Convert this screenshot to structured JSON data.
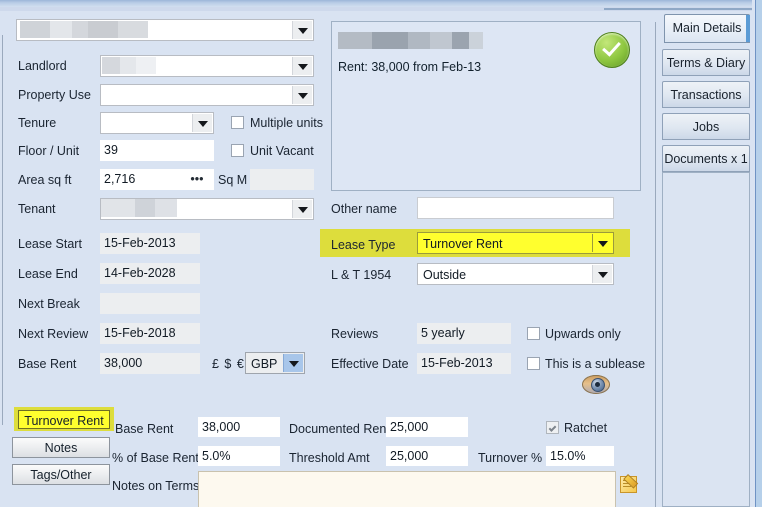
{
  "window": {
    "title": ""
  },
  "left_form": {
    "property_combo": {
      "label": "",
      "value": "",
      "redacted": true
    },
    "rows": [
      {
        "label": "Landlord",
        "value": "",
        "type": "combo",
        "redacted": true
      },
      {
        "label": "Property Use",
        "value": "",
        "type": "combo"
      },
      {
        "label": "Tenure",
        "value": "",
        "type": "combo"
      },
      {
        "label": "Floor / Unit",
        "value": "39",
        "type": "text"
      },
      {
        "label": "Area sq ft",
        "value": "2,716",
        "type": "text"
      },
      {
        "label": "Tenant",
        "value": "",
        "type": "combo",
        "redacted": true
      },
      {
        "label": "Lease Start",
        "value": "15-Feb-2013",
        "type": "text"
      },
      {
        "label": "Lease End",
        "value": "14-Feb-2028",
        "type": "text"
      },
      {
        "label": "Next Break",
        "value": "",
        "type": "text"
      },
      {
        "label": "Next Review",
        "value": "15-Feb-2018",
        "type": "text"
      },
      {
        "label": "Base Rent",
        "value": "38,000",
        "type": "text"
      }
    ],
    "checkboxes": [
      {
        "label": "Multiple units",
        "checked": false
      },
      {
        "label": "Unit Vacant",
        "checked": false
      }
    ],
    "sq_m": {
      "label": "Sq M",
      "value": ""
    },
    "area_ellipsis": "•••",
    "currency": {
      "symbols": "£ $ €",
      "value": "GBP"
    }
  },
  "summary_panel": {
    "redacted_title": "",
    "line": "Rent: 38,000 from Feb-13",
    "status_icon": "green-check-icon"
  },
  "right_form": {
    "other_name": {
      "label": "Other name",
      "value": ""
    },
    "lease_type": {
      "label": "Lease Type",
      "value": "Turnover Rent",
      "highlight_color": "#ffff2e",
      "band_color": "#dddd3c"
    },
    "lt_1954": {
      "label": "L & T 1954",
      "value": "Outside"
    },
    "reviews": {
      "label": "Reviews",
      "value": "5 yearly"
    },
    "effective_date": {
      "label": "Effective Date",
      "value": "15-Feb-2013"
    },
    "checkboxes": [
      {
        "label": "Upwards only",
        "checked": false
      },
      {
        "label": "This is a sublease",
        "checked": false
      }
    ],
    "eye_icon": "eye-icon"
  },
  "bottom": {
    "side_buttons": [
      {
        "label": "Turnover Rent",
        "active": true
      },
      {
        "label": "Notes",
        "active": false
      },
      {
        "label": "Tags/Other",
        "active": false
      }
    ],
    "fields": [
      {
        "label": "Base Rent",
        "value": "38,000"
      },
      {
        "label": "Documented Rent",
        "value": "25,000"
      },
      {
        "label": "% of Base Rent",
        "value": "5.0%"
      },
      {
        "label": "Threshold Amt",
        "value": "25,000"
      },
      {
        "label": "Turnover %",
        "value": "15.0%"
      }
    ],
    "ratchet": {
      "label": "Ratchet",
      "checked": true
    },
    "notes_on_terms": {
      "label": "Notes on Terms",
      "value": ""
    },
    "note_icon": "note-pencil-icon"
  },
  "tabs": {
    "items": [
      {
        "label": "Main Details",
        "active": true
      },
      {
        "label": "Terms & Diary",
        "active": false
      },
      {
        "label": "Transactions",
        "active": false
      },
      {
        "label": "Jobs",
        "active": false
      },
      {
        "label": "Documents x 1",
        "active": false
      }
    ]
  },
  "colors": {
    "background": "#d9e3f2",
    "highlight_yellow": "#ffff2e",
    "band_yellow": "#dddd3c",
    "field_gray": "#eceef0",
    "accent_blue": "#5b9bd5",
    "status_green": "#8dc63f"
  }
}
